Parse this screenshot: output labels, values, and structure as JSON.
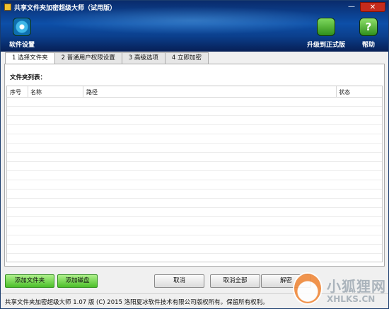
{
  "window": {
    "title": "共享文件夹加密超级大师（试用版）",
    "minimize_glyph": "—",
    "close_glyph": "✕"
  },
  "toolbar": {
    "settings_label": "软件设置",
    "settings_icon": "gear-icon",
    "upgrade_label": "升级到正式版",
    "upgrade_icon": "cart-icon",
    "help_label": "帮助",
    "help_icon": "help-icon",
    "help_glyph": "?"
  },
  "tabs": [
    {
      "label": "1 选择文件夹",
      "active": true
    },
    {
      "label": "2 普通用户权限设置",
      "active": false
    },
    {
      "label": "3 高级选项",
      "active": false
    },
    {
      "label": "4 立即加密",
      "active": false
    }
  ],
  "main": {
    "list_label": "文件夹列表：",
    "columns": [
      "序号",
      "名称",
      "路径",
      "状态"
    ],
    "rows": []
  },
  "buttons": {
    "add_folder": "添加文件夹",
    "add_disk": "添加磁盘",
    "cancel": "取消",
    "cancel_all": "取消全部",
    "decrypt": "解密"
  },
  "statusbar": {
    "text": "共享文件夹加密超级大师 1.07 版 (C) 2015 洛阳夏冰软件技术有限公司版权所有。保留所有权利。"
  },
  "watermark": {
    "text_cn": "小狐狸网",
    "text_en": "XHLKS.CN"
  },
  "colors": {
    "header": "#0d4fa8",
    "close": "#c42b1c",
    "green_button": "#4cbf2a"
  }
}
